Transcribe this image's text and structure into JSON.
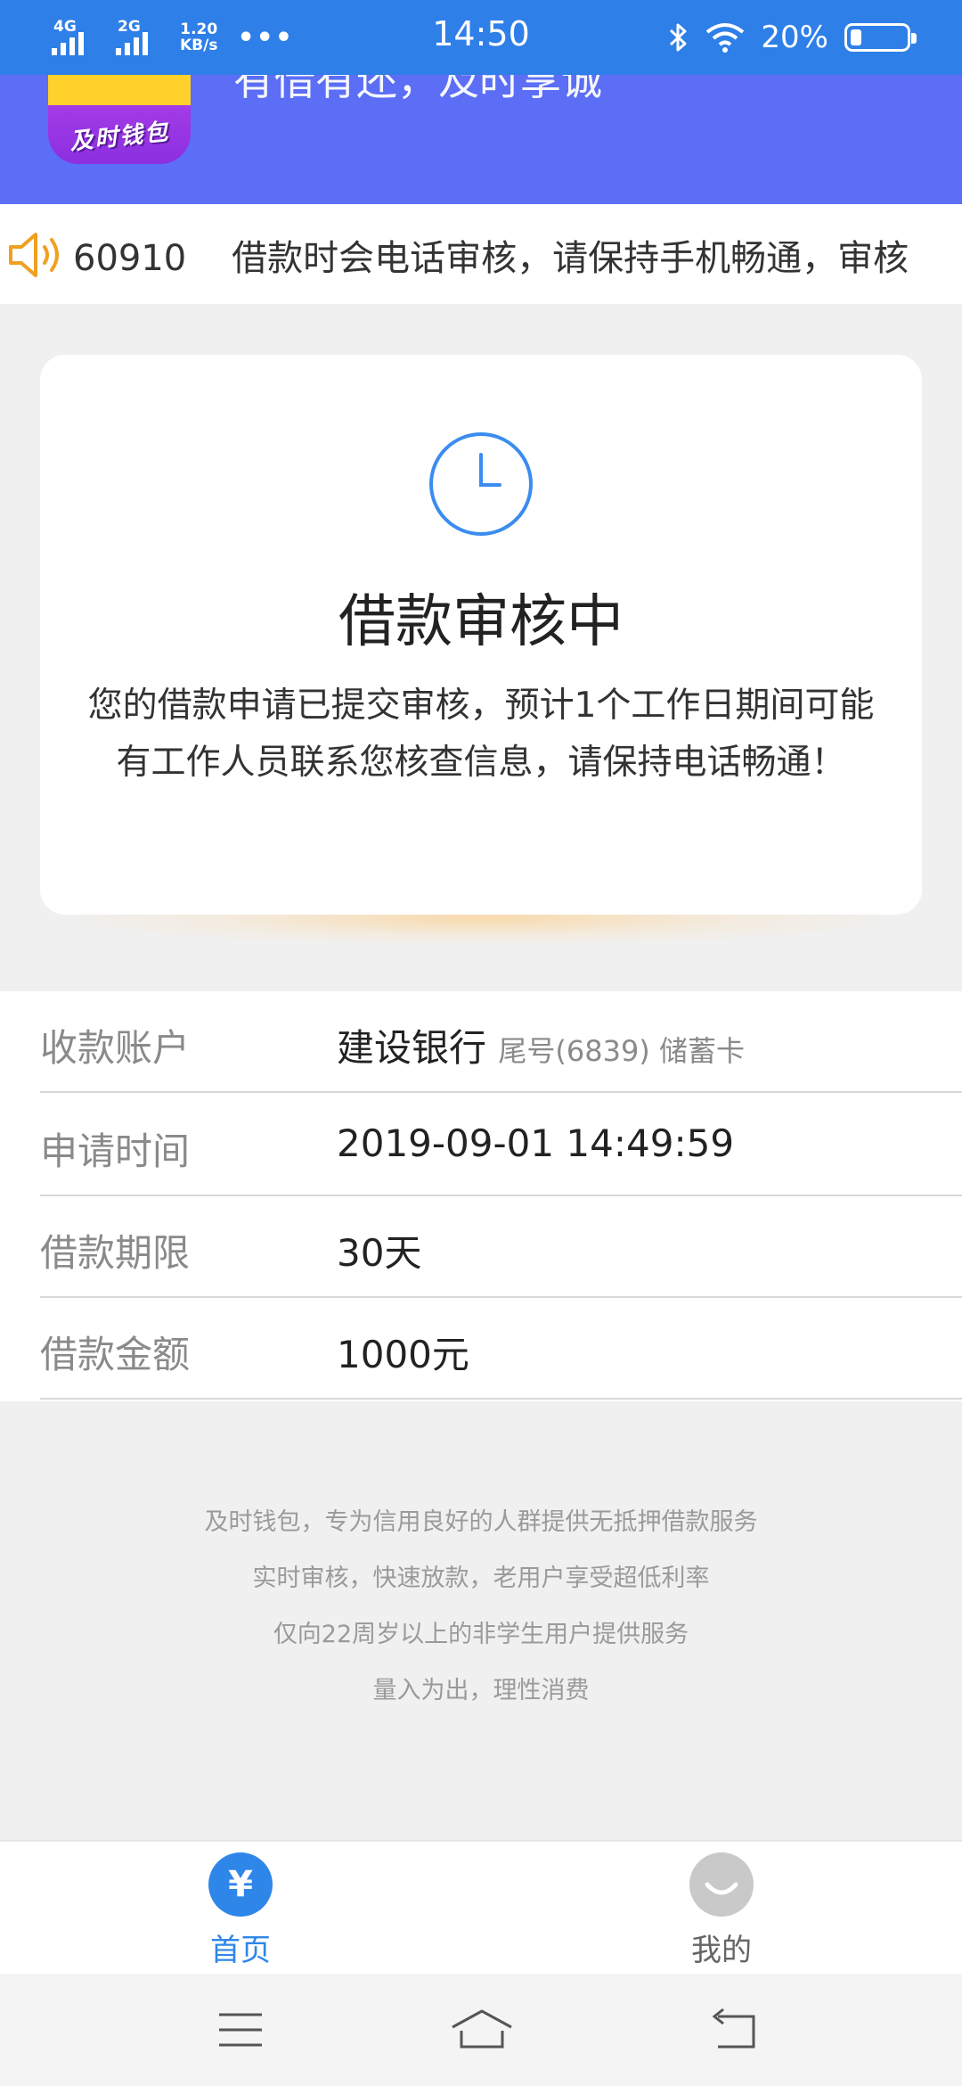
{
  "status_bar": {
    "signal1_label": "4G",
    "signal2_label": "2G",
    "speed_value": "1.20",
    "speed_unit": "KB/s",
    "more": "•••",
    "time": "14:50",
    "battery_percent": "20%",
    "battery_level": 0.2
  },
  "header": {
    "logo_text": "及时钱包",
    "slogan": "有借有还，及时享诚"
  },
  "notice": {
    "text": "60910    借款时会电话审核，请保持手机畅通，审核"
  },
  "status_card": {
    "title": "借款审核中",
    "description": "您的借款申请已提交审核，预计1个工作日期间可能有工作人员联系您核查信息，请保持电话畅通！"
  },
  "info": {
    "account_label": "收款账户",
    "account_bank": "建设银行",
    "account_detail": "尾号(6839) 储蓄卡",
    "time_label": "申请时间",
    "time_value": "2019-09-01 14:49:59",
    "term_label": "借款期限",
    "term_value": "30天",
    "amount_label": "借款金额",
    "amount_value": "1000元"
  },
  "footer_notes": [
    "及时钱包，专为信用良好的人群提供无抵押借款服务",
    "实时审核，快速放款，老用户享受超低利率",
    "仅向22周岁以上的非学生用户提供服务",
    "量入为出，理性消费"
  ],
  "tabbar": {
    "home_icon_glyph": "¥",
    "home_label": "首页",
    "mine_label": "我的"
  },
  "colors": {
    "status_bar": "#2f7fe8",
    "header": "#5b6ef5",
    "accent": "#2f86e9",
    "speaker": "#f0a020"
  },
  "icons": {
    "speaker": "speaker-icon",
    "clock": "clock-icon",
    "home": "yen-icon",
    "mine": "smile-icon",
    "nav": [
      "menu-icon",
      "home-icon",
      "back-icon"
    ]
  }
}
